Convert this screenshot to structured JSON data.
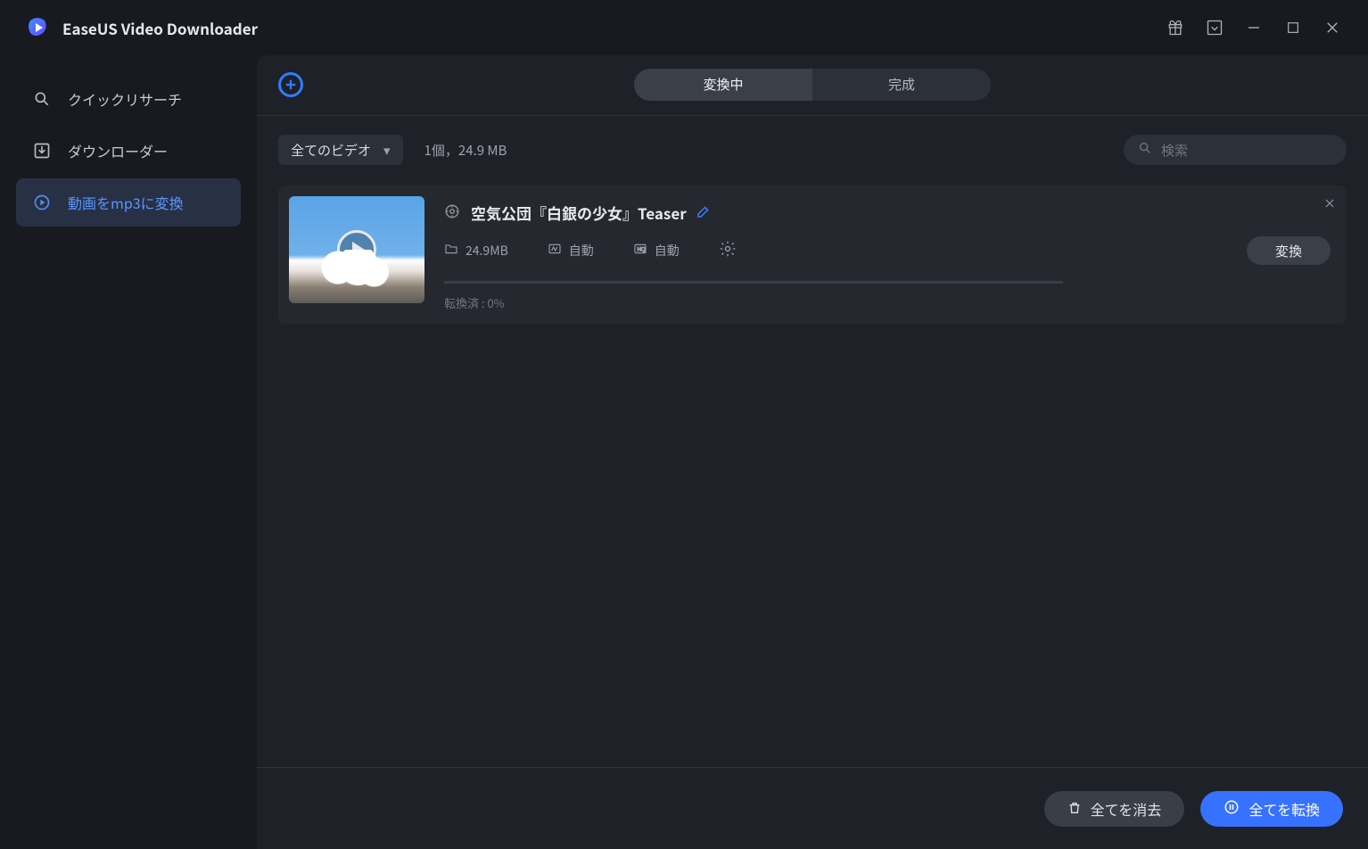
{
  "app": {
    "title": "EaseUS Video Downloader"
  },
  "sidebar": {
    "items": [
      {
        "label": "クイックリサーチ"
      },
      {
        "label": "ダウンローダー"
      },
      {
        "label": "動画をmp3に変換"
      }
    ]
  },
  "tabs": {
    "converting": "変換中",
    "done": "完成"
  },
  "filter": {
    "label": "全てのビデオ"
  },
  "summary": {
    "text": "1個，24.9 MB"
  },
  "search": {
    "placeholder": "検索"
  },
  "item": {
    "title": "空気公団『白銀の少女』Teaser",
    "size": "24.9MB",
    "quality": "自動",
    "format": "自動",
    "convert_label": "変換",
    "status": "転換済 : 0%"
  },
  "footer": {
    "clear": "全てを消去",
    "convert_all": "全てを転換"
  }
}
